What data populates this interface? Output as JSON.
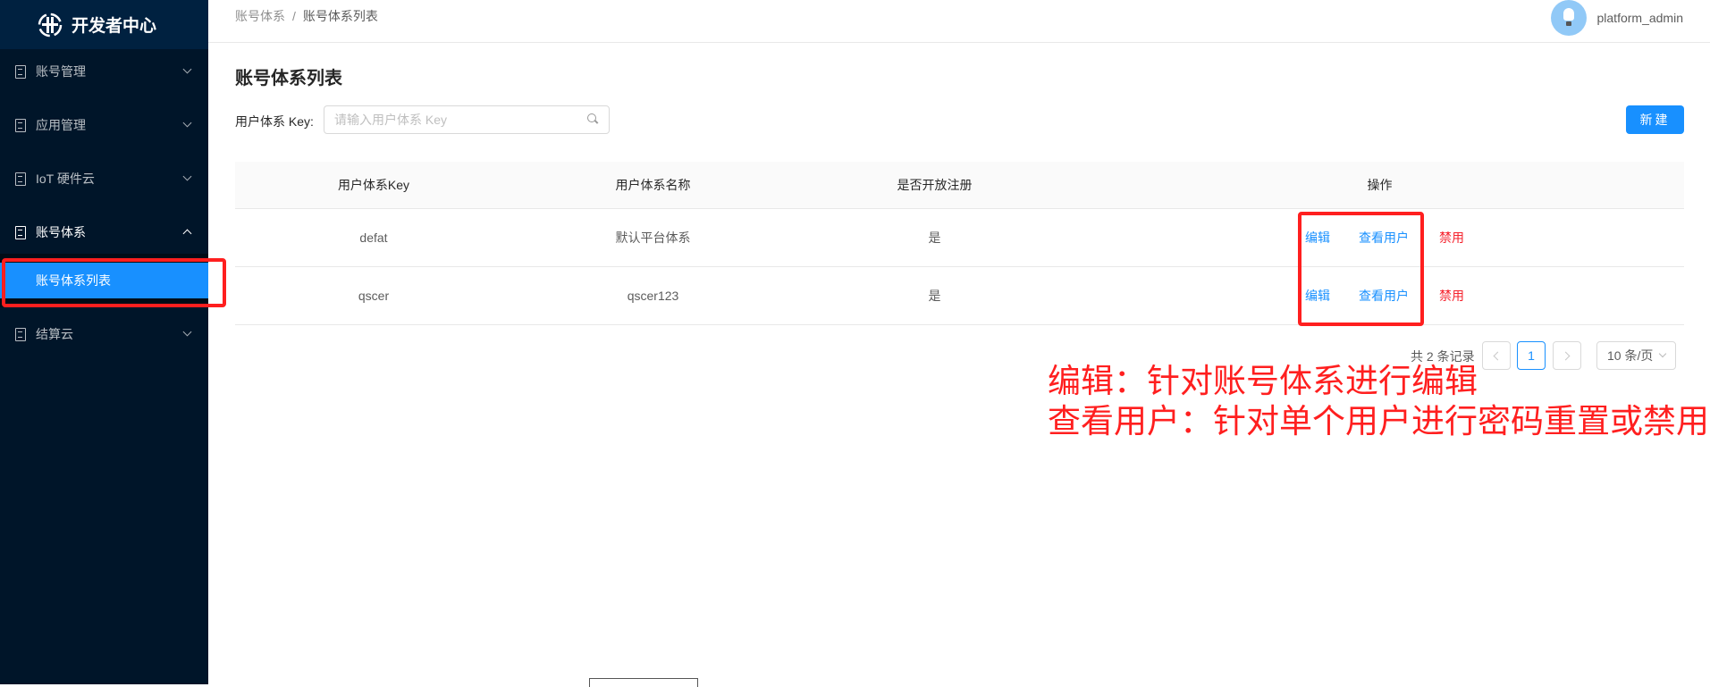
{
  "app": {
    "title": "开发者中心"
  },
  "sidebar": {
    "items": [
      {
        "label": "账号管理"
      },
      {
        "label": "应用管理"
      },
      {
        "label": "IoT 硬件云"
      },
      {
        "label": "账号体系"
      },
      {
        "label": "结算云"
      }
    ],
    "active_sub_item": "账号体系列表"
  },
  "header": {
    "breadcrumb": [
      "账号体系",
      "账号体系列表"
    ],
    "username": "platform_admin"
  },
  "page": {
    "title": "账号体系列表",
    "search_label": "用户体系 Key:",
    "search_placeholder": "请输入用户体系 Key",
    "new_button": "新建"
  },
  "table": {
    "columns": [
      "用户体系Key",
      "用户体系名称",
      "是否开放注册",
      "操作"
    ],
    "rows": [
      {
        "key": "defat",
        "name": "默认平台体系",
        "open": "是"
      },
      {
        "key": "qscer",
        "name": "qscer123",
        "open": "是"
      }
    ],
    "actions": {
      "edit": "编辑",
      "view_users": "查看用户",
      "disable": "禁用"
    }
  },
  "pagination": {
    "total": "共 2 条记录",
    "current": "1",
    "page_size": "10 条/页"
  },
  "annotation": {
    "line1": "编辑：针对账号体系进行编辑",
    "line2": "查看用户：针对单个用户进行密码重置或禁用"
  },
  "colors": {
    "sidebar_bg": "#001529",
    "primary": "#1890ff",
    "danger": "#f5222d",
    "annotation_red": "#ff1f1f"
  }
}
